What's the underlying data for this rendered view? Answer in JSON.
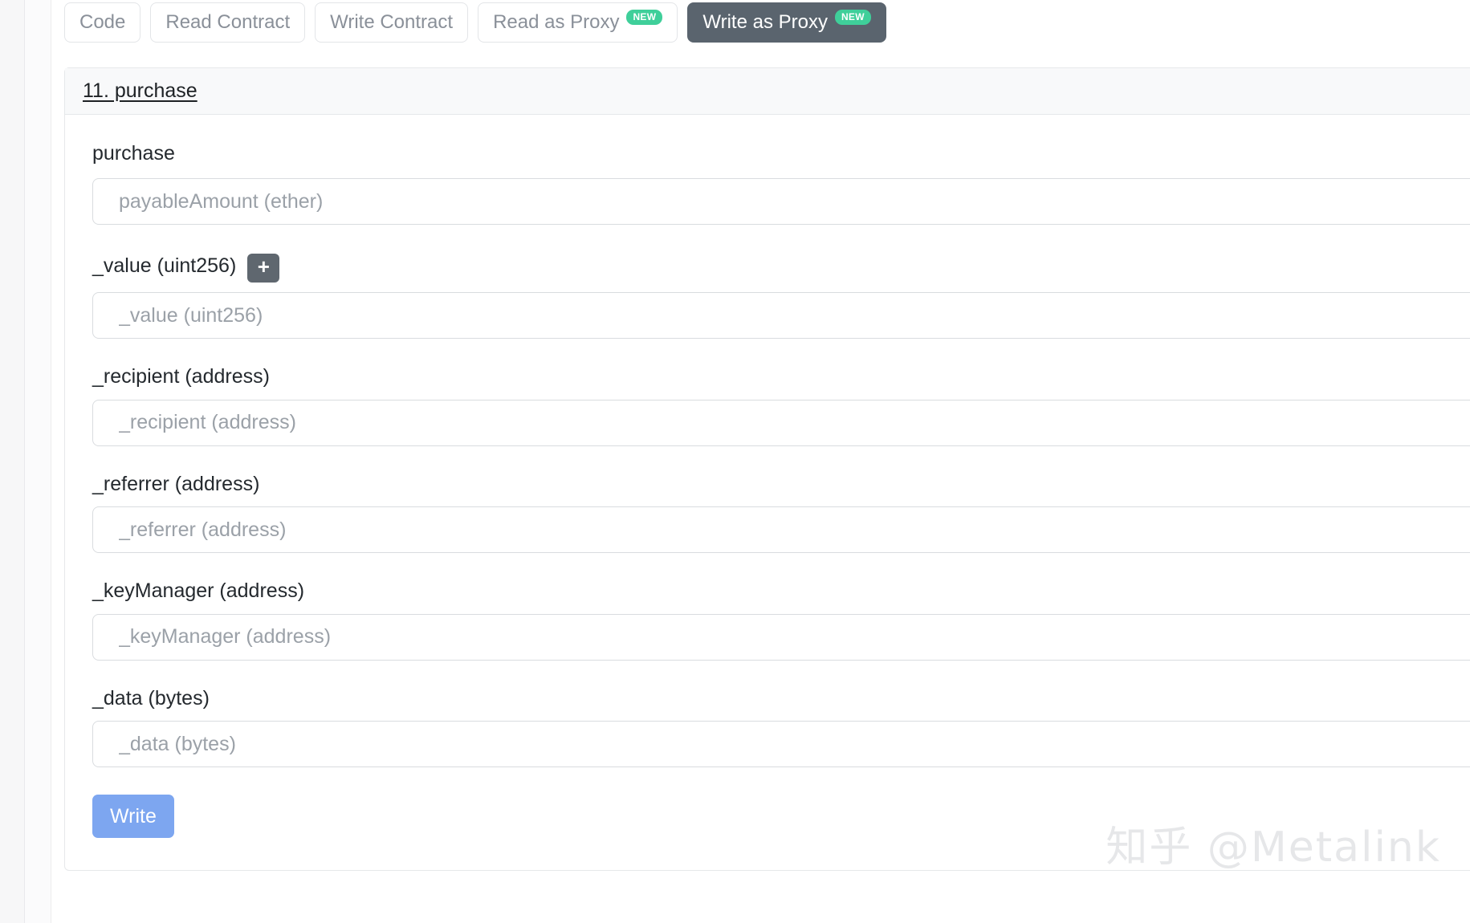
{
  "colors": {
    "accent_active_tab": "#5a646e",
    "badge_new": "#3fcf9a",
    "write_button": "#7da6f0",
    "plus_button": "#5f676f",
    "card_header_bg": "#f8f9fa",
    "border": "#e6e8ea",
    "placeholder_text": "#9ba1a8",
    "label_text": "#24292e",
    "tab_text": "#8a9099",
    "watermark": "#e6e7e9"
  },
  "tabs": [
    {
      "label": "Code",
      "active": false,
      "badge": null
    },
    {
      "label": "Read Contract",
      "active": false,
      "badge": null
    },
    {
      "label": "Write Contract",
      "active": false,
      "badge": null
    },
    {
      "label": "Read as Proxy",
      "active": false,
      "badge": "NEW"
    },
    {
      "label": "Write as Proxy",
      "active": true,
      "badge": "NEW"
    }
  ],
  "card": {
    "header_title": "11. purchase",
    "function_name": "purchase",
    "fields": [
      {
        "label": null,
        "placeholder": "payableAmount (ether)",
        "value": "",
        "has_add_button": false
      },
      {
        "label": "_value (uint256)",
        "placeholder": "_value (uint256)",
        "value": "",
        "has_add_button": true,
        "add_button_label": "+"
      },
      {
        "label": "_recipient (address)",
        "placeholder": "_recipient (address)",
        "value": "",
        "has_add_button": false
      },
      {
        "label": "_referrer (address)",
        "placeholder": "_referrer (address)",
        "value": "",
        "has_add_button": false
      },
      {
        "label": "_keyManager (address)",
        "placeholder": "_keyManager (address)",
        "value": "",
        "has_add_button": false
      },
      {
        "label": "_data (bytes)",
        "placeholder": "_data (bytes)",
        "value": "",
        "has_add_button": false
      }
    ],
    "submit_label": "Write"
  },
  "watermark": {
    "text": "知乎 @Metalink"
  }
}
